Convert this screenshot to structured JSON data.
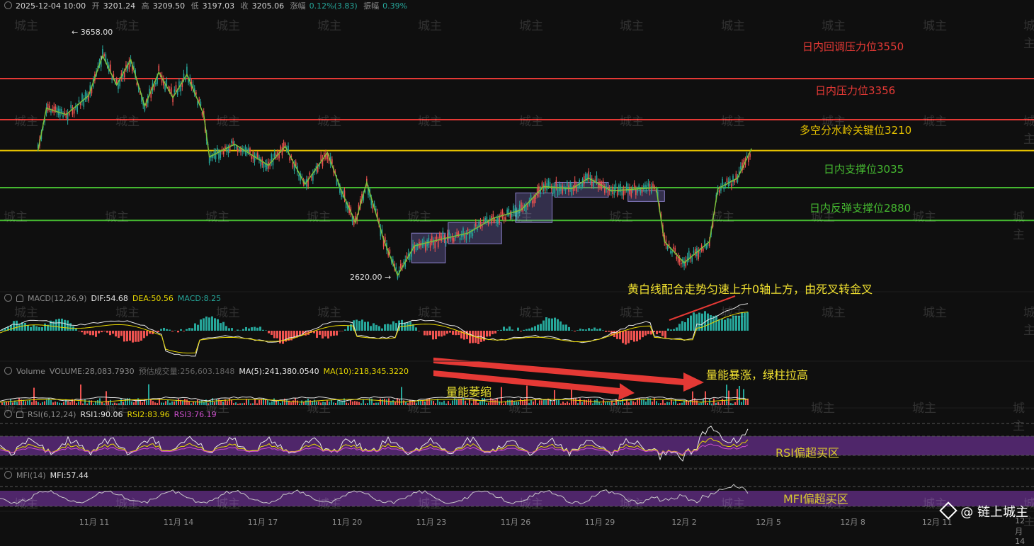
{
  "header": {
    "datetime": "2025-12-04 10:00",
    "open_label": "开",
    "open": "3201.24",
    "high_label": "高",
    "high": "3209.50",
    "low_label": "低",
    "low": "3197.03",
    "close_label": "收",
    "close": "3205.06",
    "change_label": "涨幅",
    "change": "0.12%(3.83)",
    "amp_label": "振幅",
    "amp": "0.39%"
  },
  "panes": {
    "macd": {
      "name": "MACD(12,26,9)",
      "dif": "DIF:54.68",
      "dea": "DEA:50.56",
      "macd": "MACD:8.25"
    },
    "volume": {
      "name": "Volume",
      "vol": "VOLUME:28,083.7930",
      "est": "预估成交量:256,603.1848",
      "ma5": "MA(5):241,380.0540",
      "ma10": "MA(10):218,345.3220"
    },
    "rsi": {
      "name": "RSI(6,12,24)",
      "rsi1": "RSI1:90.06",
      "rsi2": "RSI2:83.96",
      "rsi3": "RSI3:76.19"
    },
    "mfi": {
      "name": "MFI(14)",
      "mfi": "MFI:57.44"
    }
  },
  "levels": [
    {
      "label": "日内回调压力位3550",
      "price": 3550,
      "color": "#e53935"
    },
    {
      "label": "日内压力位3356",
      "price": 3356,
      "color": "#e53935"
    },
    {
      "label": "多空分水岭关键位3210",
      "price": 3210,
      "color": "#e5c100"
    },
    {
      "label": "日内支撑位3035",
      "price": 3035,
      "color": "#45b830"
    },
    {
      "label": "日内反弹支撑位2880",
      "price": 2880,
      "color": "#45b830"
    }
  ],
  "price_marks": {
    "high": "← 3658.00",
    "low": "2620.00 →"
  },
  "annotations": {
    "macd": "黄白线配合走势匀速上升0轴上方，由死叉转金叉",
    "volume_surge": "量能暴涨，绿柱拉高",
    "volume_shrink": "量能萎缩",
    "rsi_zone": "RSI偏超买区",
    "mfi_zone": "MFI偏超买区"
  },
  "watermark": "城主",
  "brand": "@ 链上城主",
  "colors": {
    "up": "#26a69a",
    "down": "#ef5350",
    "zigzag": "#7cc13a",
    "box": "#7e6fb5",
    "zone": "#5b2a7a"
  },
  "chart_data": {
    "type": "candlestick",
    "x_axis_ticks": [
      "11月 11",
      "11月 14",
      "11月 17",
      "11月 20",
      "11月 23",
      "11月 26",
      "11月 29",
      "12月 2",
      "12月 5",
      "12月 8",
      "12月 11",
      "12月 14"
    ],
    "price_path_keypoints": [
      {
        "date": "11月 9",
        "price": 3210
      },
      {
        "date": "11月 9.3",
        "price": 3410
      },
      {
        "date": "11月 10",
        "price": 3380
      },
      {
        "date": "11月 10.8",
        "price": 3470
      },
      {
        "date": "11月 11.3",
        "price": 3658
      },
      {
        "date": "11月 11.8",
        "price": 3520
      },
      {
        "date": "11月 12.3",
        "price": 3640
      },
      {
        "date": "11月 12.8",
        "price": 3420
      },
      {
        "date": "11月 13.3",
        "price": 3580
      },
      {
        "date": "11月 13.8",
        "price": 3460
      },
      {
        "date": "11月 14.3",
        "price": 3570
      },
      {
        "date": "11月 14.9",
        "price": 3380
      },
      {
        "date": "11月 15.1",
        "price": 3180
      },
      {
        "date": "11月 16",
        "price": 3240
      },
      {
        "date": "11月 17.2",
        "price": 3140
      },
      {
        "date": "11月 17.8",
        "price": 3230
      },
      {
        "date": "11月 18.5",
        "price": 3050
      },
      {
        "date": "11月 19.3",
        "price": 3200
      },
      {
        "date": "11月 19.8",
        "price": 3020
      },
      {
        "date": "11月 20.3",
        "price": 2870
      },
      {
        "date": "11月 20.7",
        "price": 3060
      },
      {
        "date": "11月 21.3",
        "price": 2790
      },
      {
        "date": "11月 21.8",
        "price": 2620
      },
      {
        "date": "11月 22.4",
        "price": 2760
      },
      {
        "date": "11月 23.3",
        "price": 2790
      },
      {
        "date": "11月 24.3",
        "price": 2820
      },
      {
        "date": "11月 25.2",
        "price": 2890
      },
      {
        "date": "11月 26.2",
        "price": 2930
      },
      {
        "date": "11月 27.0",
        "price": 3040
      },
      {
        "date": "11月 28.0",
        "price": 3030
      },
      {
        "date": "11月 28.6",
        "price": 3080
      },
      {
        "date": "11月 29.4",
        "price": 3020
      },
      {
        "date": "11月 30.5",
        "price": 3030
      },
      {
        "date": "12月 1.0",
        "price": 3035
      },
      {
        "date": "12月 1.3",
        "price": 2780
      },
      {
        "date": "12月 2.0",
        "price": 2680
      },
      {
        "date": "12月 2.9",
        "price": 2780
      },
      {
        "date": "12月 3.2",
        "price": 3030
      },
      {
        "date": "12月 3.9",
        "price": 3080
      },
      {
        "date": "12月 4.4",
        "price": 3220
      }
    ],
    "consolidation_boxes": [
      {
        "from": "11月 22.3",
        "to": "11月 23.5",
        "low": 2680,
        "high": 2820
      },
      {
        "from": "11月 23.6",
        "to": "11月 25.5",
        "low": 2770,
        "high": 2870
      },
      {
        "from": "11月 26.0",
        "to": "11月 27.3",
        "low": 2870,
        "high": 3010
      },
      {
        "from": "11月 27.4",
        "to": "11月 29.3",
        "low": 2990,
        "high": 3060
      },
      {
        "from": "11月 30.0",
        "to": "12月 1.3",
        "low": 2970,
        "high": 3020
      }
    ],
    "xlabel": "",
    "ylabel": ""
  }
}
